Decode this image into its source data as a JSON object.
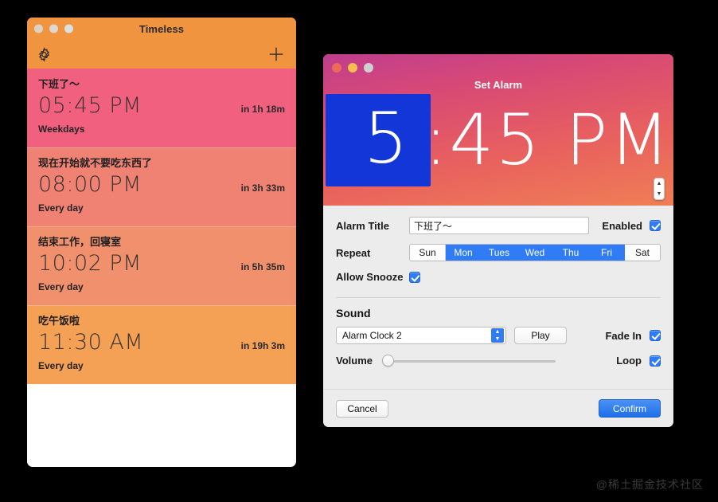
{
  "timeless": {
    "title": "Timeless",
    "toolbar": {
      "settings_icon": "gear-icon",
      "add_icon": "plus-icon"
    },
    "traffic_lights": [
      "close",
      "minimize",
      "zoom"
    ],
    "alarms": [
      {
        "name": "下班了～",
        "time": "05:45 PM",
        "eta": "in 1h 18m",
        "repeat": "Weekdays",
        "bg": "#f2607f"
      },
      {
        "name": "现在开始就不要吃东西了",
        "time": "08:00 PM",
        "eta": "in 3h 33m",
        "repeat": "Every day",
        "bg": "#f08274"
      },
      {
        "name": "结束工作，回寝室",
        "time": "10:02 PM",
        "eta": "in 5h 35m",
        "repeat": "Every day",
        "bg": "#f1906c"
      },
      {
        "name": "吃午饭啦",
        "time": "11:30 AM",
        "eta": "in 19h 3m",
        "repeat": "Every day",
        "bg": "#f4a055"
      }
    ]
  },
  "set_alarm": {
    "title": "Set Alarm",
    "time_hour": "5",
    "time_rest": ":45 PM",
    "stepper": {
      "up": "▲",
      "down": "▼"
    },
    "fields": {
      "alarm_title_label": "Alarm Title",
      "alarm_title_value": "下班了～",
      "enabled_label": "Enabled",
      "enabled_checked": true,
      "repeat_label": "Repeat",
      "allow_snooze_label": "Allow Snooze",
      "allow_snooze_checked": true
    },
    "repeat_days": [
      {
        "label": "Sun",
        "selected": false
      },
      {
        "label": "Mon",
        "selected": true
      },
      {
        "label": "Tues",
        "selected": true
      },
      {
        "label": "Wed",
        "selected": true
      },
      {
        "label": "Thu",
        "selected": true
      },
      {
        "label": "Fri",
        "selected": true
      },
      {
        "label": "Sat",
        "selected": false
      }
    ],
    "sound": {
      "section_title": "Sound",
      "selected_sound": "Alarm Clock 2",
      "play_label": "Play",
      "fade_in_label": "Fade In",
      "fade_in_checked": true,
      "volume_label": "Volume",
      "volume_value": 0,
      "loop_label": "Loop",
      "loop_checked": true
    },
    "footer": {
      "cancel_label": "Cancel",
      "confirm_label": "Confirm"
    }
  },
  "watermark": "@稀土掘金技术社区"
}
